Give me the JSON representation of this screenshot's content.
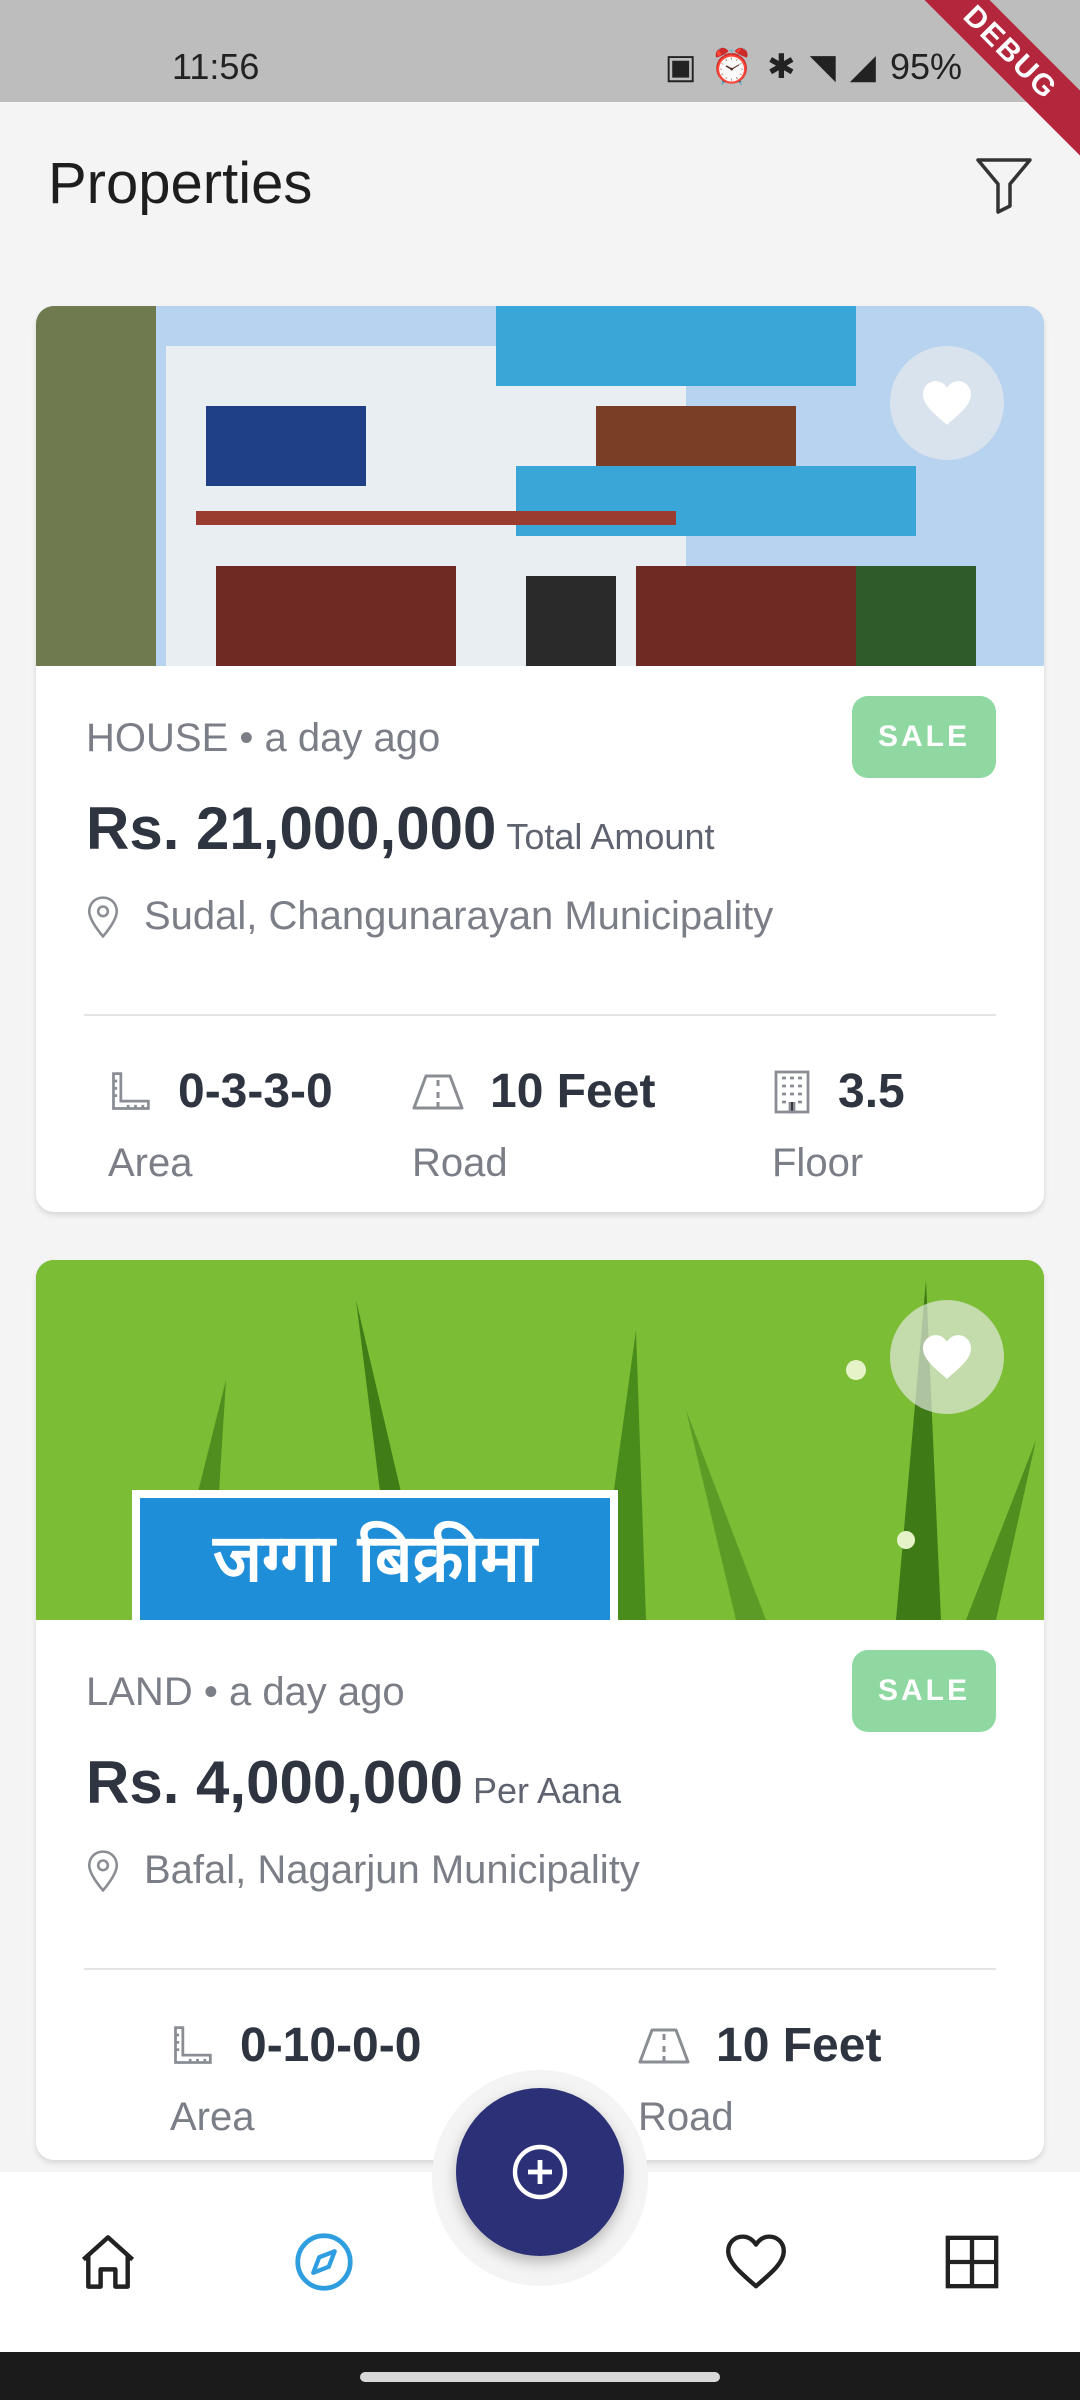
{
  "status_bar": {
    "time": "11:56",
    "battery": "95%",
    "debug_banner": "DEBUG"
  },
  "app_bar": {
    "title": "Properties"
  },
  "listings": [
    {
      "type": "HOUSE",
      "posted": "a day ago",
      "badge": "SALE",
      "price": "Rs. 21,000,000",
      "price_unit": "Total Amount",
      "location": "Sudal, Changunarayan Municipality",
      "stats": [
        {
          "value": "0-3-3-0",
          "label": "Area"
        },
        {
          "value": "10 Feet",
          "label": "Road"
        },
        {
          "value": "3.5",
          "label": "Floor"
        }
      ]
    },
    {
      "type": "LAND",
      "posted": "a day ago",
      "badge": "SALE",
      "price": "Rs. 4,000,000",
      "price_unit": "Per Aana",
      "location": "Bafal, Nagarjun  Municipality",
      "image_text": "जग्गा बिक्रीमा",
      "stats": [
        {
          "value": "0-10-0-0",
          "label": "Area"
        },
        {
          "value": "10 Feet",
          "label": "Road"
        }
      ]
    }
  ],
  "colors": {
    "accent": "#2b3077",
    "badge": "#8fd8a1",
    "active_nav": "#2f9ee0"
  }
}
